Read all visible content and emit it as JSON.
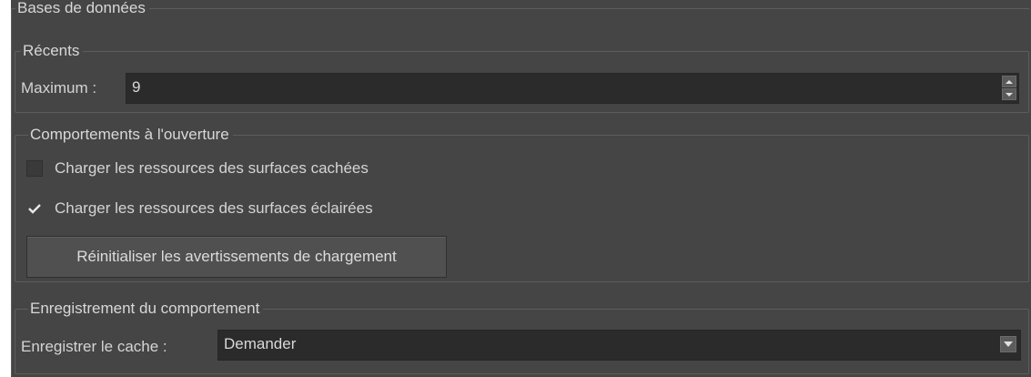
{
  "databases": {
    "title": "Bases de données",
    "recent": {
      "title": "Récents",
      "max_label": "Maximum :",
      "max_value": "9"
    },
    "opening": {
      "title": "Comportements à l'ouverture",
      "hidden_label": "Charger les ressources des surfaces cachées",
      "hidden_checked": false,
      "lit_label": "Charger les ressources des surfaces éclairées",
      "lit_checked": true,
      "reset_button": "Réinitialiser les avertissements de chargement"
    },
    "saving": {
      "title": "Enregistrement du comportement",
      "cache_label": "Enregistrer le cache :",
      "cache_value": "Demander"
    }
  }
}
